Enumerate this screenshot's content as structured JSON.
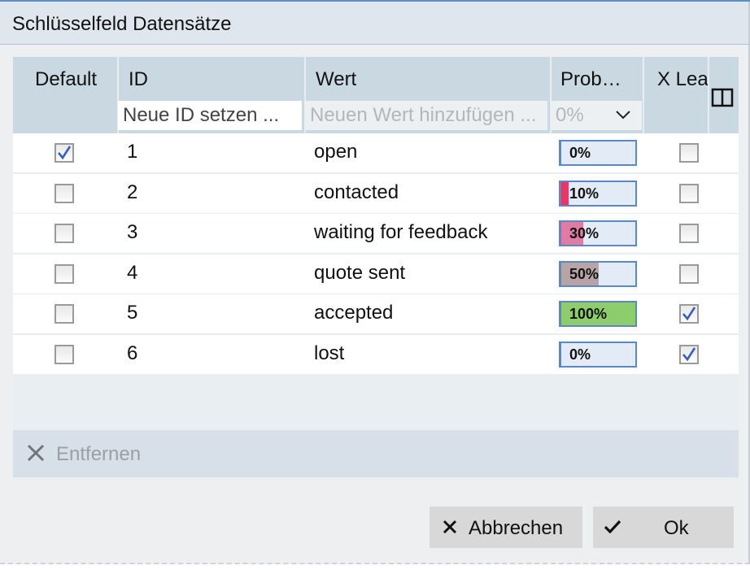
{
  "dialog": {
    "title": "Schlüsselfeld Datensätze"
  },
  "table": {
    "columns": {
      "default": "Default",
      "id": "ID",
      "wert": "Wert",
      "prob": "Prob…",
      "xlead": "X Lea"
    },
    "filters": {
      "id_placeholder": "Neue ID setzen ...",
      "wert_placeholder": "Neuen Wert hinzufügen ...",
      "prob_value": "0%"
    },
    "rows": [
      {
        "default": true,
        "id": "1",
        "wert": "open",
        "prob": "0%",
        "prob_fraction": 0.0,
        "prob_color": "#e2ebf6",
        "xlead": false
      },
      {
        "default": false,
        "id": "2",
        "wert": "contacted",
        "prob": "10%",
        "prob_fraction": 0.1,
        "prob_color": "#e8366a",
        "xlead": false
      },
      {
        "default": false,
        "id": "3",
        "wert": "waiting for feedback",
        "prob": "30%",
        "prob_fraction": 0.3,
        "prob_color": "#e07ba3",
        "xlead": false
      },
      {
        "default": false,
        "id": "4",
        "wert": "quote sent",
        "prob": "50%",
        "prob_fraction": 0.5,
        "prob_color": "#b8a3a6",
        "xlead": false
      },
      {
        "default": false,
        "id": "5",
        "wert": "accepted",
        "prob": "100%",
        "prob_fraction": 1.0,
        "prob_color": "#8ecd6e",
        "xlead": true
      },
      {
        "default": false,
        "id": "6",
        "wert": "lost",
        "prob": "0%",
        "prob_fraction": 0.0,
        "prob_color": "#e2ebf6",
        "xlead": true
      }
    ]
  },
  "toolbar": {
    "remove_label": "Entfernen",
    "remove_icon": "close-icon"
  },
  "buttons": {
    "cancel_label": "Abbrechen",
    "cancel_icon": "close-icon",
    "ok_label": "Ok",
    "ok_icon": "checkmark-icon"
  },
  "colors": {
    "header_bg": "#cad8e2",
    "title_bg": "#dfe6ee",
    "progress_border": "#5b87c5",
    "checkmark": "#3a5fb5"
  }
}
